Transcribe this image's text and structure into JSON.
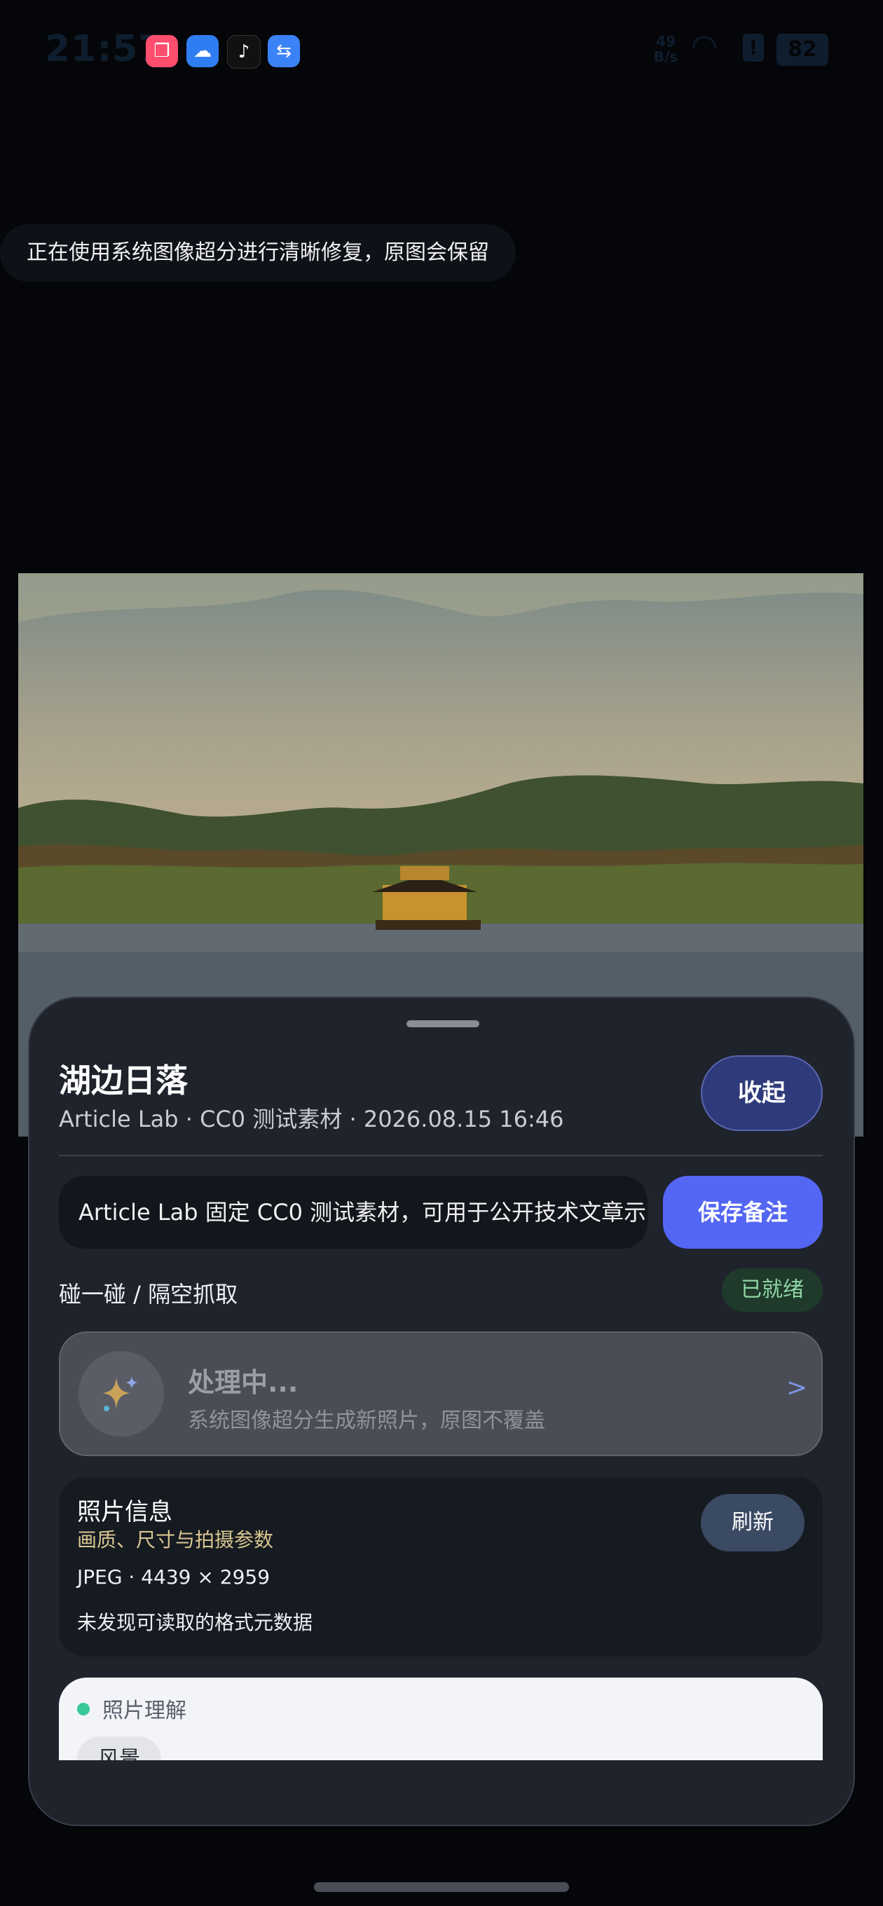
{
  "status_bar": {
    "time": "21:57",
    "net_speed": "49 B/s",
    "battery": "82",
    "icons": [
      "reader-app-icon",
      "weather-app-icon",
      "tiktok-app-icon",
      "usb-icon",
      "wifi-icon",
      "alert-icon"
    ]
  },
  "toast": {
    "text": "正在使用系统图像超分进行清晰修复，原图会保留"
  },
  "sheet": {
    "title": "湖边日落",
    "meta": "Article Lab · CC0 测试素材 · 2026.08.15 16:46",
    "collapse_label": "收起",
    "note_value": "Article Lab 固定 CC0 测试素材，可用于公开技术文章示",
    "save_label": "保存备注",
    "touch_label": "碰一碰 / 隔空抓取",
    "ready_label": "已就绪",
    "processing": {
      "title": "处理中...",
      "subtitle": "系统图像超分生成新照片，原图不覆盖",
      "chevron": ">"
    },
    "photo_info": {
      "title": "照片信息",
      "subtitle": "画质、尺寸与拍摄参数",
      "format_line": "JPEG · 4439 × 2959",
      "metadata_line": "未发现可读取的格式元数据",
      "refresh_label": "刷新"
    },
    "understanding": {
      "title": "照片理解",
      "tag": "风景"
    }
  },
  "colors": {
    "accent": "#5466f4",
    "sheet_bg": "#1f232c",
    "ready_green": "#8fd6a4"
  }
}
